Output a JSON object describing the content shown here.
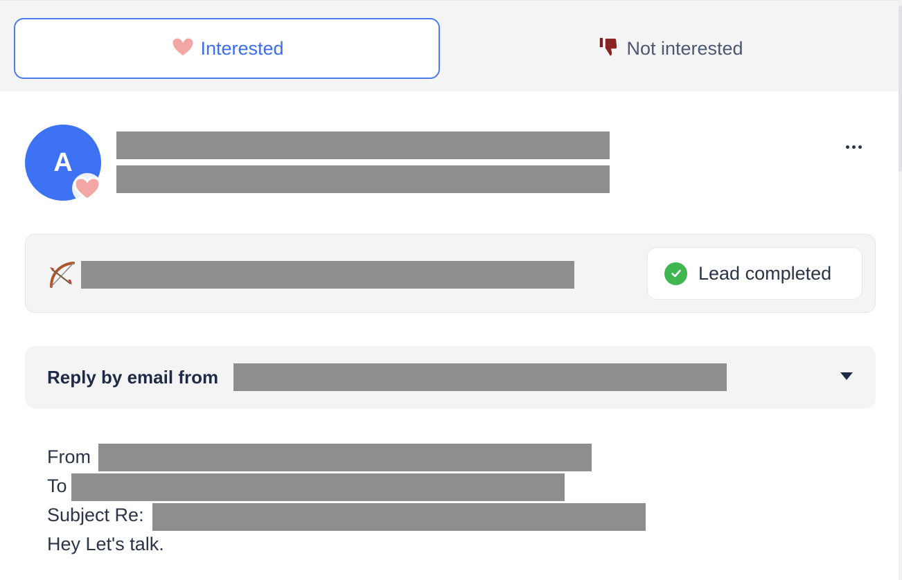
{
  "tabs": {
    "interested": {
      "label": "Interested"
    },
    "not_interested": {
      "label": "Not interested"
    }
  },
  "lead": {
    "avatar_initial": "A",
    "status": "Lead completed"
  },
  "reply": {
    "label": "Reply by email from"
  },
  "email": {
    "from_label": "From",
    "to_label": "To",
    "subject_label": "Subject Re:",
    "body": "Hey Let's talk."
  },
  "colors": {
    "accent": "#3b6df0",
    "avatar": "#3e72f4",
    "success": "#3fb650",
    "redaction": "#8e8e8e"
  }
}
